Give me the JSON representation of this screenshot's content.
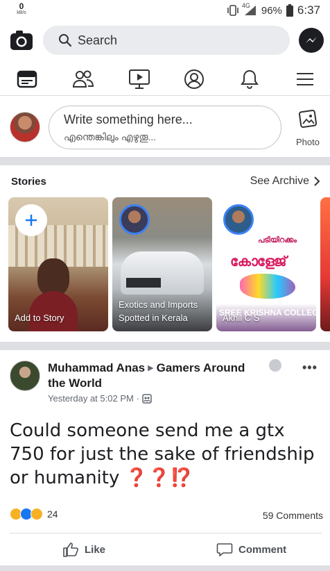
{
  "status_bar": {
    "net_speed_value": "0",
    "net_speed_unit": "kB/s",
    "network": "4G",
    "battery": "96%",
    "time": "6:37"
  },
  "top_bar": {
    "search_placeholder": "Search"
  },
  "nav": {
    "items": [
      "news-feed",
      "friends",
      "watch",
      "profile",
      "notifications",
      "menu"
    ]
  },
  "composer": {
    "placeholder_en": "Write something here...",
    "placeholder_ml": "എന്തെങ്കിലും എഴുതൂ...",
    "photo_label": "Photo"
  },
  "stories": {
    "title": "Stories",
    "archive_label": "See Archive",
    "items": [
      {
        "caption": "Add to Story"
      },
      {
        "caption_line1": "Exotics and Imports",
        "caption_line2": "Spotted in Kerala"
      },
      {
        "caption": "Akhil C S",
        "overlay_text": "SREE KRISHNA COLLEGE",
        "banner": "പടിയിറക്കം",
        "poster": "കോളേജ്"
      }
    ]
  },
  "post": {
    "author": "Muhammad Anas",
    "group": "Gamers Around the World",
    "time": "Yesterday at 5:02 PM",
    "text_main": "Could someone send me a gtx 750 for just the sake of friendship or humanity",
    "text_emoji": "❓❓⁉️",
    "reaction_count": "24",
    "comment_count": "59 Comments",
    "like_label": "Like",
    "comment_label": "Comment",
    "more_label": "•••"
  },
  "colors": {
    "blue": "#1877f2",
    "grey_bg": "#e9ebee",
    "divider": "#dddfe2"
  }
}
